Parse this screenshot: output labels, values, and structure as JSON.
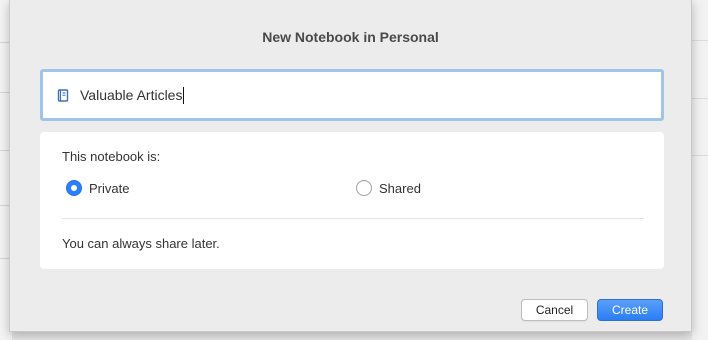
{
  "dialog": {
    "title": "New Notebook in Personal",
    "notebook_name": {
      "value": "Valuable Articles",
      "icon": "notebook-icon"
    },
    "sharing": {
      "label": "This notebook is:",
      "options": [
        {
          "label": "Private",
          "selected": true
        },
        {
          "label": "Shared",
          "selected": false
        }
      ],
      "hint": "You can always share later."
    },
    "buttons": {
      "cancel": "Cancel",
      "create": "Create"
    }
  },
  "colors": {
    "accent": "#2d7ff9",
    "focus_ring": "#9fc5ea",
    "sheet_background": "#ececec",
    "panel_background": "#ffffff"
  }
}
